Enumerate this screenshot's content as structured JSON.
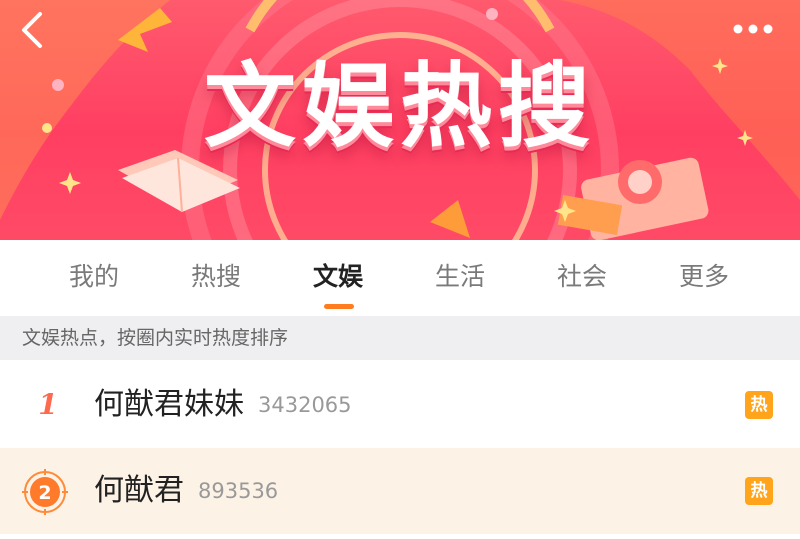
{
  "banner": {
    "title": "文娱热搜",
    "back_icon": "chevron-left-icon",
    "more_icon": "more-dots-icon"
  },
  "tabs": [
    {
      "label": "我的",
      "active": false
    },
    {
      "label": "热搜",
      "active": false
    },
    {
      "label": "文娱",
      "active": true
    },
    {
      "label": "生活",
      "active": false
    },
    {
      "label": "社会",
      "active": false
    },
    {
      "label": "更多",
      "active": false
    }
  ],
  "subheader": {
    "text": "文娱热点，按圈内实时热度排序"
  },
  "list": [
    {
      "rank": "1",
      "title": "何猷君妹妹",
      "count": "3432065",
      "badge": "热"
    },
    {
      "rank": "2",
      "title": "何猷君",
      "count": "893536",
      "badge": "热"
    }
  ],
  "colors": {
    "accent": "#ff7d1e",
    "banner": "#ff4a66",
    "hot_badge": "#ffa41b",
    "rank_red": "#ff6a4e",
    "rank_orange": "#ff7a2a",
    "highlight_row": "#fdf2e6"
  }
}
